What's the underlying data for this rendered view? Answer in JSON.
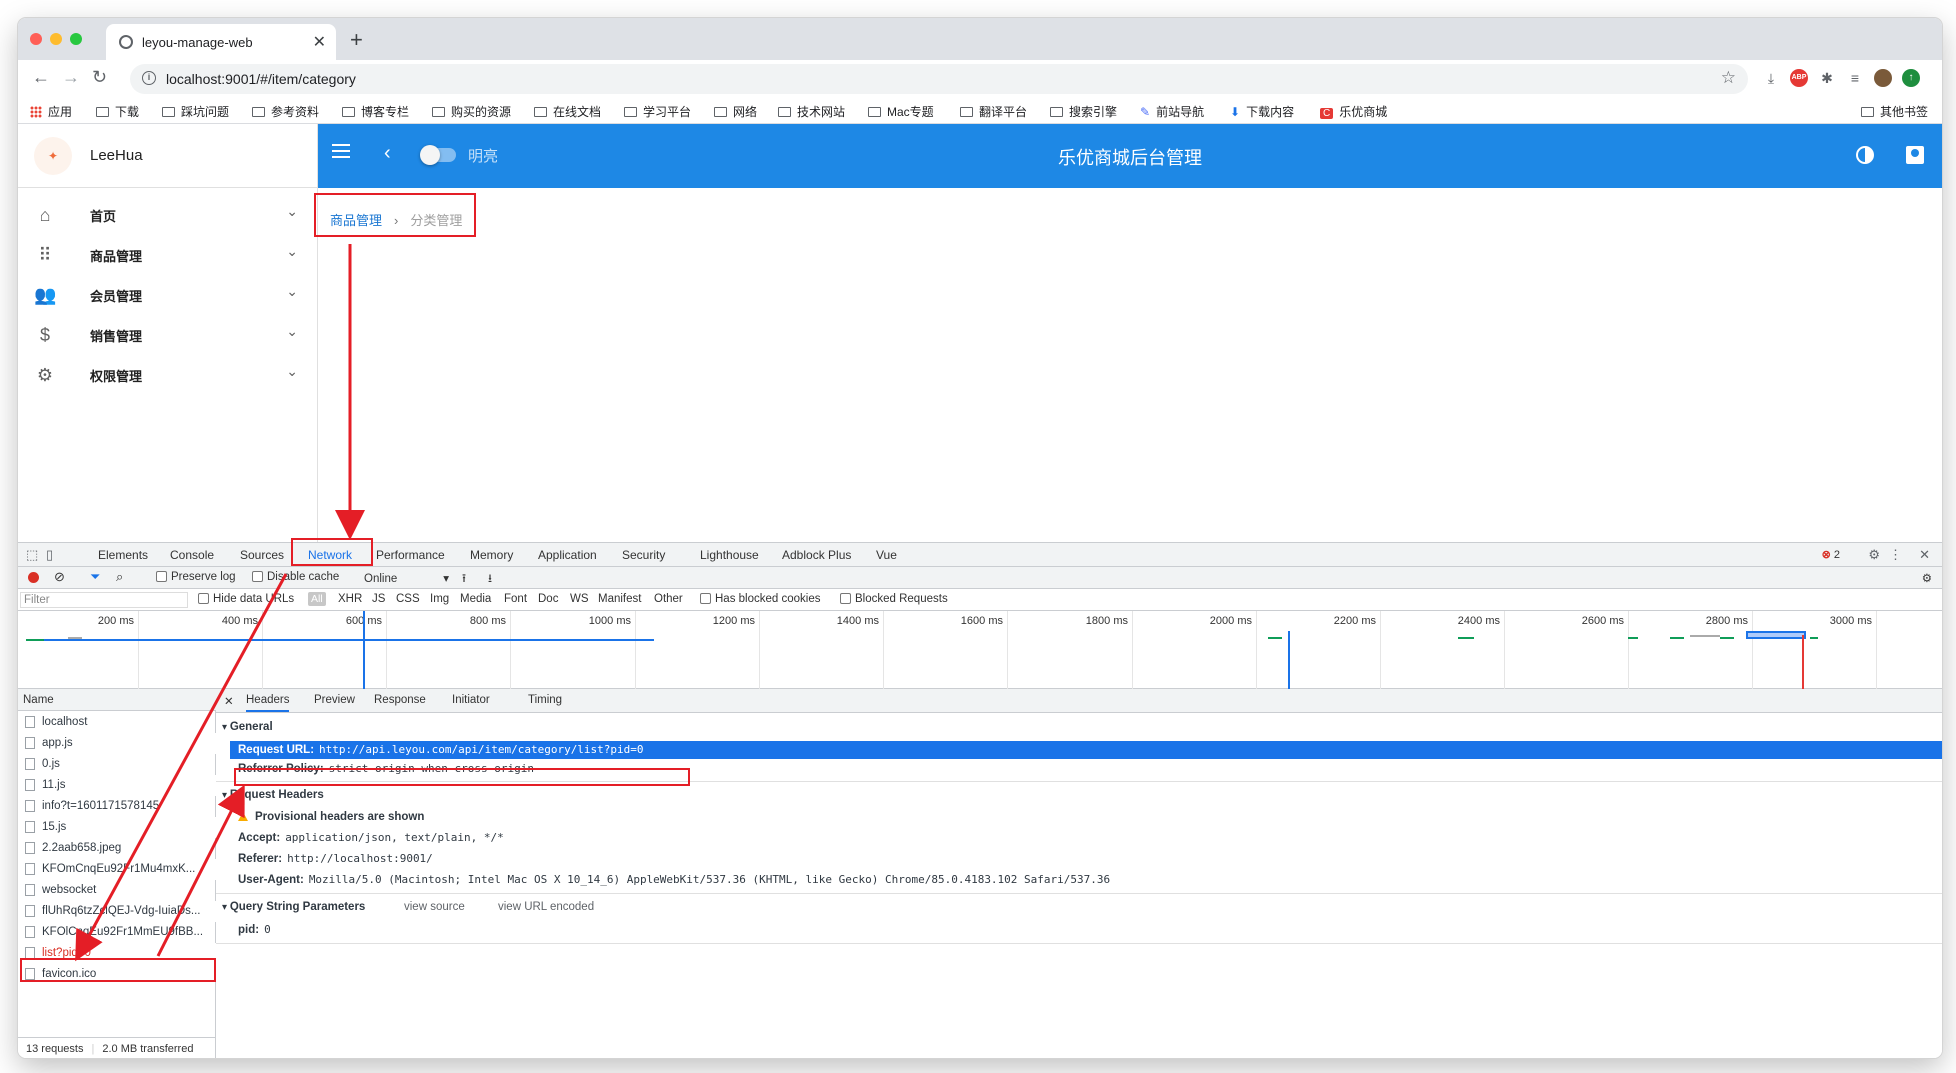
{
  "browser": {
    "tab_title": "leyou-manage-web",
    "url": "localhost:9001/#/item/category",
    "bookmarks": [
      "应用",
      "下载",
      "踩坑问题",
      "参考资料",
      "博客专栏",
      "购买的资源",
      "在线文档",
      "学习平台",
      "网络",
      "技术网站",
      "Mac专题",
      "翻译平台",
      "搜索引擎",
      "前站导航",
      "下载内容",
      "乐优商城"
    ],
    "other_bookmarks": "其他书签"
  },
  "app": {
    "user": "LeeHua",
    "title": "乐优商城后台管理",
    "theme_label": "明亮",
    "menu": [
      {
        "label": "首页",
        "icon": "home-icon"
      },
      {
        "label": "商品管理",
        "icon": "apps-grid-icon"
      },
      {
        "label": "会员管理",
        "icon": "people-icon"
      },
      {
        "label": "销售管理",
        "icon": "dollar-icon"
      },
      {
        "label": "权限管理",
        "icon": "gear-icon"
      }
    ],
    "breadcrumb": {
      "parent": "商品管理",
      "current": "分类管理"
    }
  },
  "devtools": {
    "tabs": [
      "Elements",
      "Console",
      "Sources",
      "Network",
      "Performance",
      "Memory",
      "Application",
      "Security",
      "Lighthouse",
      "Adblock Plus",
      "Vue"
    ],
    "active_tab": "Network",
    "error_count": "2",
    "toolbar": {
      "preserve_log": "Preserve log",
      "disable_cache": "Disable cache",
      "throttle": "Online"
    },
    "filter": {
      "placeholder": "Filter",
      "hide_data_urls": "Hide data URLs",
      "all": "All",
      "types": [
        "XHR",
        "JS",
        "CSS",
        "Img",
        "Media",
        "Font",
        "Doc",
        "WS",
        "Manifest",
        "Other"
      ],
      "has_blocked_cookies": "Has blocked cookies",
      "blocked_requests": "Blocked Requests"
    },
    "timeline_ticks": [
      "200 ms",
      "400 ms",
      "600 ms",
      "800 ms",
      "1000 ms",
      "1200 ms",
      "1400 ms",
      "1600 ms",
      "1800 ms",
      "2000 ms",
      "2200 ms",
      "2400 ms",
      "2600 ms",
      "2800 ms",
      "3000 ms"
    ],
    "name_header": "Name",
    "requests": [
      "localhost",
      "app.js",
      "0.js",
      "11.js",
      "info?t=1601171578145",
      "15.js",
      "2.2aab658.jpeg",
      "KFOmCnqEu92Fr1Mu4mxK...",
      "websocket",
      "flUhRq6tzZclQEJ-Vdg-IuiaDs...",
      "KFOlCnqEu92Fr1MmEU9fBB...",
      "list?pid=0",
      "favicon.ico"
    ],
    "summary": {
      "requests": "13 requests",
      "transferred": "2.0 MB transferred"
    },
    "detail_tabs": [
      "Headers",
      "Preview",
      "Response",
      "Initiator",
      "Timing"
    ],
    "general": {
      "title": "General",
      "request_url_label": "Request URL:",
      "request_url": "http://api.leyou.com/api/item/category/list?pid=0",
      "referrer_policy_label": "Referrer Policy:",
      "referrer_policy": "strict-origin-when-cross-origin"
    },
    "request_headers": {
      "title": "Request Headers",
      "warning": "Provisional headers are shown",
      "accept_label": "Accept:",
      "accept": "application/json, text/plain, */*",
      "referer_label": "Referer:",
      "referer": "http://localhost:9001/",
      "user_agent_label": "User-Agent:",
      "user_agent": "Mozilla/5.0 (Macintosh; Intel Mac OS X 10_14_6) AppleWebKit/537.36 (KHTML, like Gecko) Chrome/85.0.4183.102 Safari/537.36"
    },
    "query_params": {
      "title": "Query String Parameters",
      "view_source": "view source",
      "view_url_encoded": "view URL encoded",
      "pid_label": "pid:",
      "pid": "0"
    }
  },
  "colors": {
    "appbar": "#1e88e5",
    "annotation": "#e41e26",
    "selection": "#1a73e8"
  }
}
